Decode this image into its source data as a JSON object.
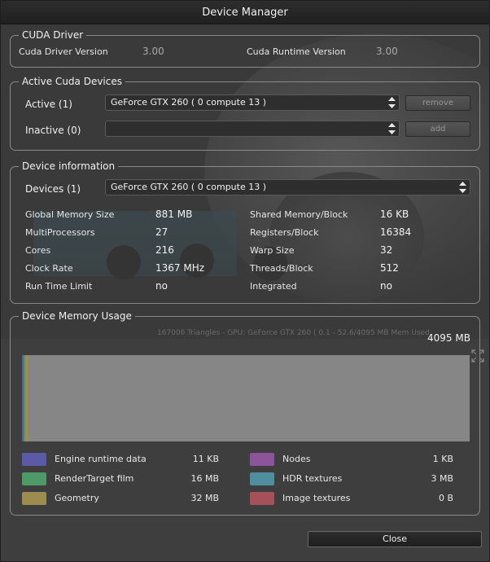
{
  "window": {
    "title": "Device Manager"
  },
  "cuda_driver": {
    "title": "CUDA Driver",
    "driver_version_label": "Cuda Driver Version",
    "driver_version": "3.00",
    "runtime_version_label": "Cuda Runtime Version",
    "runtime_version": "3.00"
  },
  "active_devices": {
    "title": "Active Cuda Devices",
    "active_label": "Active (1)",
    "active_selected": "GeForce GTX 260 ( 0 compute 13 )",
    "inactive_label": "Inactive (0)",
    "inactive_selected": "",
    "remove_label": "remove",
    "add_label": "add"
  },
  "device_info": {
    "title": "Device information",
    "devices_label": "Devices (1)",
    "devices_selected": "GeForce GTX 260 ( 0 compute 13 )",
    "left": [
      {
        "label": "Global Memory Size",
        "value": "881 MB"
      },
      {
        "label": "MultiProcessors",
        "value": "27"
      },
      {
        "label": "Cores",
        "value": "216"
      },
      {
        "label": "Clock Rate",
        "value": "1367 MHz"
      },
      {
        "label": "Run Time Limit",
        "value": "no"
      }
    ],
    "right": [
      {
        "label": "Shared Memory/Block",
        "value": "16 KB"
      },
      {
        "label": "Registers/Block",
        "value": "16384"
      },
      {
        "label": "Warp Size",
        "value": "32"
      },
      {
        "label": "Threads/Block",
        "value": "512"
      },
      {
        "label": "Integrated",
        "value": "no"
      }
    ]
  },
  "memory_usage": {
    "title": "Device Memory Usage",
    "total": "4095 MB",
    "background_status": "167006 Triangles - GPU: GeForce GTX 260 ( 0.1 - 52.6/4095 MB Mem Used",
    "bar_segments": [
      {
        "name": "Engine runtime data",
        "fraction": 2e-05,
        "color": "#5a5aa6"
      },
      {
        "name": "RenderTarget film",
        "fraction": 0.0039,
        "color": "#4d9a66"
      },
      {
        "name": "Geometry",
        "fraction": 0.0078,
        "color": "#9c8c4e"
      }
    ],
    "legend": [
      {
        "label": "Engine runtime data",
        "value": "11 KB",
        "color": "#5a5aa6"
      },
      {
        "label": "RenderTarget film",
        "value": "16 MB",
        "color": "#4d9a66"
      },
      {
        "label": "Geometry",
        "value": "32 MB",
        "color": "#9c8c4e"
      },
      {
        "label": "Nodes",
        "value": "1 KB",
        "color": "#8c549a"
      },
      {
        "label": "HDR textures",
        "value": "3 MB",
        "color": "#4f8e9c"
      },
      {
        "label": "Image textures",
        "value": "0 B",
        "color": "#a6515a"
      }
    ]
  },
  "footer": {
    "close_label": "Close"
  }
}
